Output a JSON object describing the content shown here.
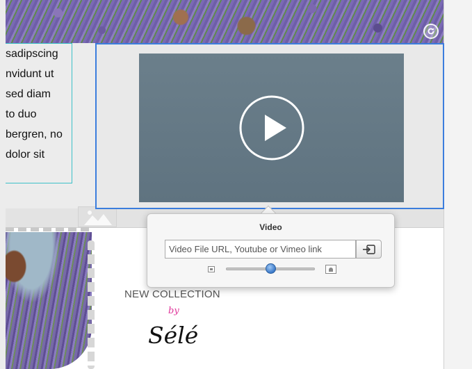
{
  "text_box": {
    "lines": [
      "sadipscing",
      "nvidunt ut",
      "sed diam",
      "to duo",
      "bergren, no",
      "dolor sit"
    ]
  },
  "canvas": {
    "new_collection": "NEW COLLECTION",
    "by": "by",
    "brand": "Sélé"
  },
  "video_popover": {
    "title": "Video",
    "url_placeholder": "Video File URL, Youtube or Vimeo link",
    "url_value": "",
    "size_slider_value": 0.5
  },
  "colors": {
    "selection_border": "#3b7ddd",
    "text_box_border": "#3cc0c8",
    "video_bg": "#677b87",
    "accent_pink": "#e0359a"
  },
  "icons": {
    "play": "play-icon",
    "refresh": "refresh-icon",
    "insert": "insert-link-icon",
    "small_size": "small-image-icon",
    "large_size": "large-image-icon",
    "image_placeholder": "image-placeholder-icon"
  }
}
